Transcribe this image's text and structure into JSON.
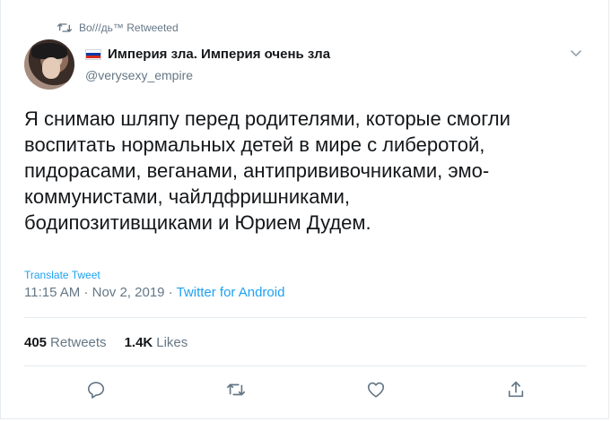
{
  "retweet": {
    "text": "Во///дь™ Retweeted",
    "icon": "retweet-icon"
  },
  "author": {
    "display_name": "Империя зла. Империя очень зла",
    "handle": "@verysexy_empire",
    "flag_colors": [
      "#ffffff",
      "#0039a6",
      "#d52b1e"
    ]
  },
  "tweet": {
    "lines": [
      "Я снимаю шляпу перед родителями, которые смогли",
      "воспитать нормальных детей в мире с либеротой,",
      "пидорасами, веганами, антипрививочниками, эмо-",
      "коммунистами, чайлдфришниками,",
      "бодипозитивщиками и Юрием Дудем."
    ]
  },
  "translate_label": "Translate Tweet",
  "meta": {
    "time": "11:15 AM",
    "sep1": " · ",
    "date": "Nov 2, 2019",
    "sep2": " · ",
    "client": "Twitter for Android"
  },
  "stats": {
    "retweets_count": "405",
    "retweets_label": "Retweets",
    "likes_count": "1.4K",
    "likes_label": "Likes"
  },
  "actions": [
    "reply-icon",
    "retweet-icon",
    "like-icon",
    "share-icon"
  ],
  "colors": {
    "accent": "#1da1f2",
    "muted": "#657786",
    "text": "#14171a",
    "border": "#e6ecf0"
  }
}
